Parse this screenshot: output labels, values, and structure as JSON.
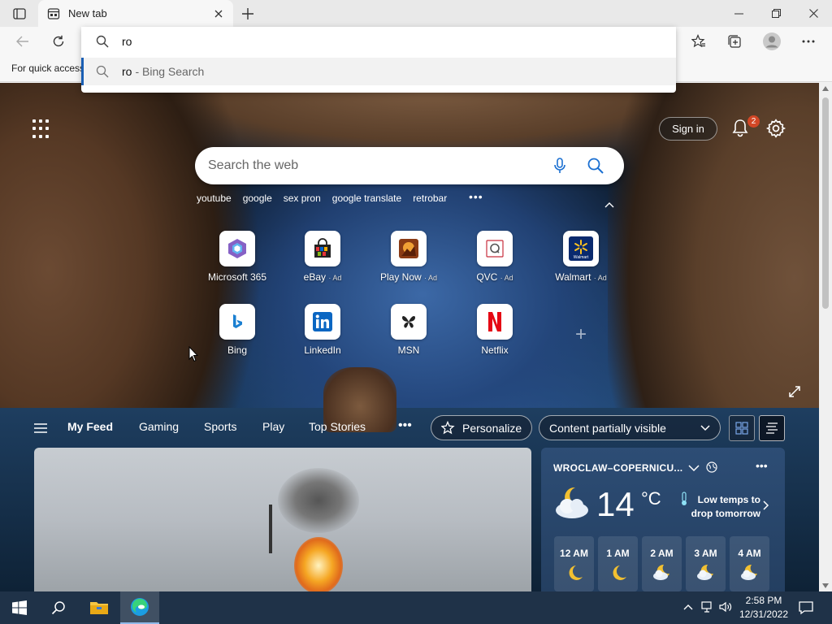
{
  "browser": {
    "tab_title": "New tab",
    "favorites_bar_text": "For quick access",
    "address": {
      "typed_value": "ro",
      "suggestion_query": "ro",
      "suggestion_source": "- Bing Search"
    }
  },
  "ntp": {
    "signin_label": "Sign in",
    "notification_count": "2",
    "search_placeholder": "Search the web",
    "trending": [
      "youtube",
      "google",
      "sex pron",
      "google translate",
      "retrobar"
    ],
    "tiles_row1": [
      {
        "label": "Microsoft 365",
        "ad": ""
      },
      {
        "label": "eBay",
        "ad": "· Ad"
      },
      {
        "label": "Play Now",
        "ad": "· Ad"
      },
      {
        "label": "QVC",
        "ad": "· Ad"
      },
      {
        "label": "Walmart",
        "ad": "· Ad"
      }
    ],
    "tiles_row2": [
      {
        "label": "Bing"
      },
      {
        "label": "LinkedIn"
      },
      {
        "label": "MSN"
      },
      {
        "label": "Netflix"
      }
    ],
    "walmart_logo_text": "Walmart",
    "feed": {
      "tabs": [
        "My Feed",
        "Gaming",
        "Sports",
        "Play",
        "Top Stories"
      ],
      "personalize_label": "Personalize",
      "content_visibility": "Content partially visible"
    },
    "weather": {
      "location": "WROCLAW–COPERNICU...",
      "temperature": "14",
      "unit": "°C",
      "alert_line1": "Low temps to",
      "alert_line2": "drop tomorrow",
      "hours": [
        "12 AM",
        "1 AM",
        "2 AM",
        "3 AM",
        "4 AM"
      ]
    }
  },
  "taskbar": {
    "time": "2:58 PM",
    "date": "12/31/2022"
  },
  "colors": {
    "taskbar": "#1f3248",
    "accent": "#1a5fb4",
    "badge": "#d24726"
  }
}
